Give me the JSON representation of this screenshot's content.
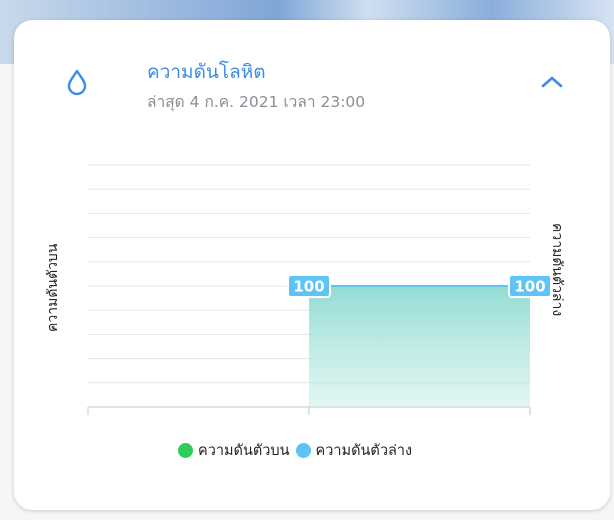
{
  "card": {
    "title": "ความดันโลหิต",
    "subtitle": "ล่าสุด 4 ก.ค. 2021 เวลา 23:00",
    "icon": "water-drop-icon",
    "collapse_icon": "chevron-up-icon",
    "accent_color": "#3a8ee6"
  },
  "chart_data": {
    "type": "area",
    "x": [
      0,
      1,
      2
    ],
    "series": [
      {
        "name": "ความดันตัวบน",
        "color": "#2ecc5b",
        "values": [
          null,
          null,
          null
        ]
      },
      {
        "name": "ความดันตัวล่าง",
        "color": "#5ec3f5",
        "values": [
          null,
          100,
          100
        ]
      }
    ],
    "data_labels": [
      "100",
      "100"
    ],
    "ylabel_left": "ความดันตัวบน",
    "ylabel_right": "ความดันตัวล่าง",
    "ylim": [
      0,
      200
    ],
    "grid": true,
    "legend_position": "bottom"
  }
}
